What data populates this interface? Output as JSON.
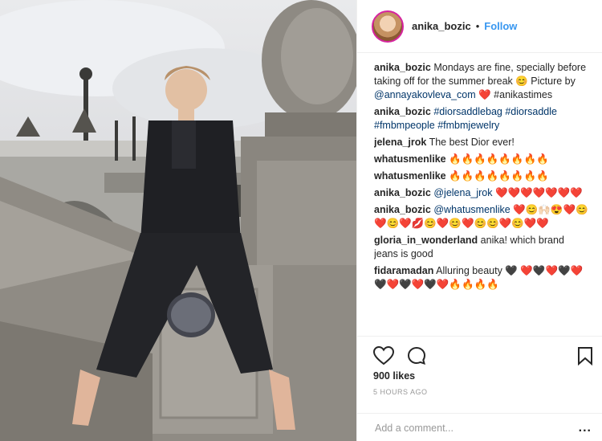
{
  "post": {
    "username": "anika_bozic",
    "follow_label": "Follow",
    "dot": "•"
  },
  "comments": [
    {
      "user": "anika_bozic",
      "text": "Mondays are fine, specially before taking off for the summer break 😊 Picture by ",
      "link": "@annayakovleva_com",
      "tail": " ❤️ #anikastimes"
    },
    {
      "user": "anika_bozic",
      "text": "",
      "link": "#diorsaddlebag #diorsaddle #fmbmpeople #fmbmjewelry",
      "tail": ""
    },
    {
      "user": "jelena_jrok",
      "text": "The best Dior ever!",
      "link": "",
      "tail": ""
    },
    {
      "user": "whatusmenlike",
      "text": "🔥🔥🔥🔥🔥🔥🔥🔥",
      "link": "",
      "tail": ""
    },
    {
      "user": "whatusmenlike",
      "text": "🔥🔥🔥🔥🔥🔥🔥🔥",
      "link": "",
      "tail": ""
    },
    {
      "user": "anika_bozic",
      "text": "",
      "link": "@jelena_jrok",
      "tail": " ❤️❤️❤️❤️❤️❤️❤️"
    },
    {
      "user": "anika_bozic",
      "text": "",
      "link": "@whatusmenlike",
      "tail": " ❤️😊🙌🏻😍❤️😊❤️😊❤️💋😊❤️😊❤️😊😊❤️😊❤️❤️"
    },
    {
      "user": "gloria_in_wonderland",
      "text": "anika! which brand jeans is good",
      "link": "",
      "tail": ""
    },
    {
      "user": "fidaramadan",
      "text": "Alluring beauty 🖤 ❤️🖤❤️🖤❤️🖤❤️🖤❤️🖤❤️🔥🔥🔥🔥",
      "link": "",
      "tail": ""
    }
  ],
  "actions": {
    "likes": "900 likes",
    "time": "5 HOURS AGO",
    "add_comment_placeholder": "Add a comment...",
    "more": "..."
  },
  "icons": [
    "heart-icon",
    "comment-icon",
    "bookmark-icon"
  ],
  "colors": {
    "follow": "#3897f0",
    "link": "#003569",
    "ring": "#d6249f"
  }
}
